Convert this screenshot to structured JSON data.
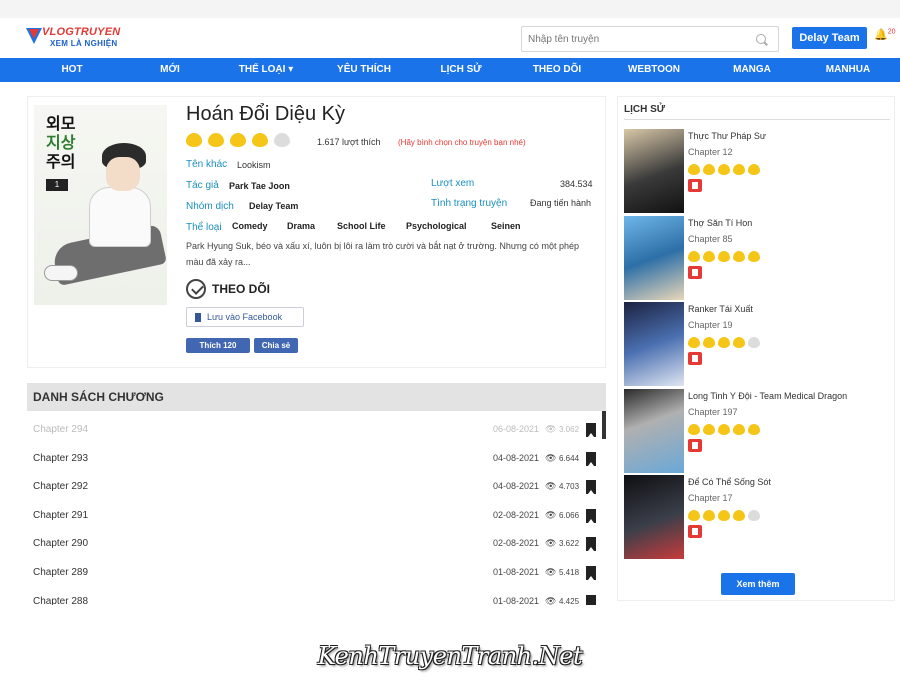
{
  "header": {
    "logo_line1": "VLOGTRUYEN",
    "logo_line2": "XEM LÀ NGHIỆN",
    "search_placeholder": "Nhập tên truyện",
    "user_button": "Delay Team",
    "notification_count": "20"
  },
  "nav": [
    "HOT",
    "MỚI",
    "THỂ LOẠI ▾",
    "YÊU THÍCH",
    "LỊCH SỬ",
    "THEO DÕI",
    "WEBTOON",
    "MANGA",
    "MANHUA"
  ],
  "manga": {
    "title": "Hoán Đổi Diệu Kỳ",
    "rating": 4,
    "rating_max": 5,
    "likes": "1.617 lượt thích",
    "rate_hint": "(Hãy bình chọn cho truyện bạn nhé)",
    "other_name_label": "Tên khác",
    "other_name": "Lookism",
    "author_label": "Tác giả",
    "author": "Park Tae Joon",
    "views_label": "Lượt xem",
    "views": "384.534",
    "team_label": "Nhóm dịch",
    "team": "Delay Team",
    "status_label": "Tình trạng truyện",
    "status": "Đang tiến hành",
    "genre_label": "Thể loại",
    "genres": [
      "Comedy",
      "Drama",
      "School Life",
      "Psychological",
      "Seinen"
    ],
    "summary": "Park Hyung Suk, béo và xấu xí, luôn bị lôi ra làm trò cười và bắt nạt ở trường. Nhưng có một phép màu đã xảy ra...",
    "follow_label": "THEO DÕI",
    "fb_save_label": "Lưu vào Facebook",
    "fb_like_label": "Thích 120",
    "fb_share_label": "Chia sẻ",
    "cover_text": [
      "외모",
      "지상",
      "주의"
    ]
  },
  "chapters": {
    "heading": "DANH SÁCH CHƯƠNG",
    "rows": [
      {
        "name": "Chapter 294",
        "date": "06-08-2021",
        "views": "3.062"
      },
      {
        "name": "Chapter 293",
        "date": "04-08-2021",
        "views": "6.644"
      },
      {
        "name": "Chapter 292",
        "date": "04-08-2021",
        "views": "4.703"
      },
      {
        "name": "Chapter 291",
        "date": "02-08-2021",
        "views": "6.066"
      },
      {
        "name": "Chapter 290",
        "date": "02-08-2021",
        "views": "3.622"
      },
      {
        "name": "Chapter 289",
        "date": "01-08-2021",
        "views": "5.418"
      },
      {
        "name": "Chapter 288",
        "date": "01-08-2021",
        "views": "4.425"
      }
    ]
  },
  "history": {
    "heading": "LỊCH SỬ",
    "items": [
      {
        "title": "Thực Thư Pháp Sư",
        "chapter": "Chapter 12",
        "rating": 5
      },
      {
        "title": "Thợ Săn Tí Hon",
        "chapter": "Chapter 85",
        "rating": 5
      },
      {
        "title": "Ranker Tái Xuất",
        "chapter": "Chapter 19",
        "rating": 4
      },
      {
        "title": "Long Tinh Y Đội - Team Medical Dragon",
        "chapter": "Chapter 197",
        "rating": 5
      },
      {
        "title": "Để Có Thể Sống Sót",
        "chapter": "Chapter 17",
        "rating": 4
      }
    ],
    "more_label": "Xem thêm"
  },
  "watermark": "KenhTruyenTranh.Net",
  "colors": {
    "accent": "#1a73e8",
    "star": "#f5c518",
    "label": "#1a8fc0",
    "danger": "#e53935"
  }
}
